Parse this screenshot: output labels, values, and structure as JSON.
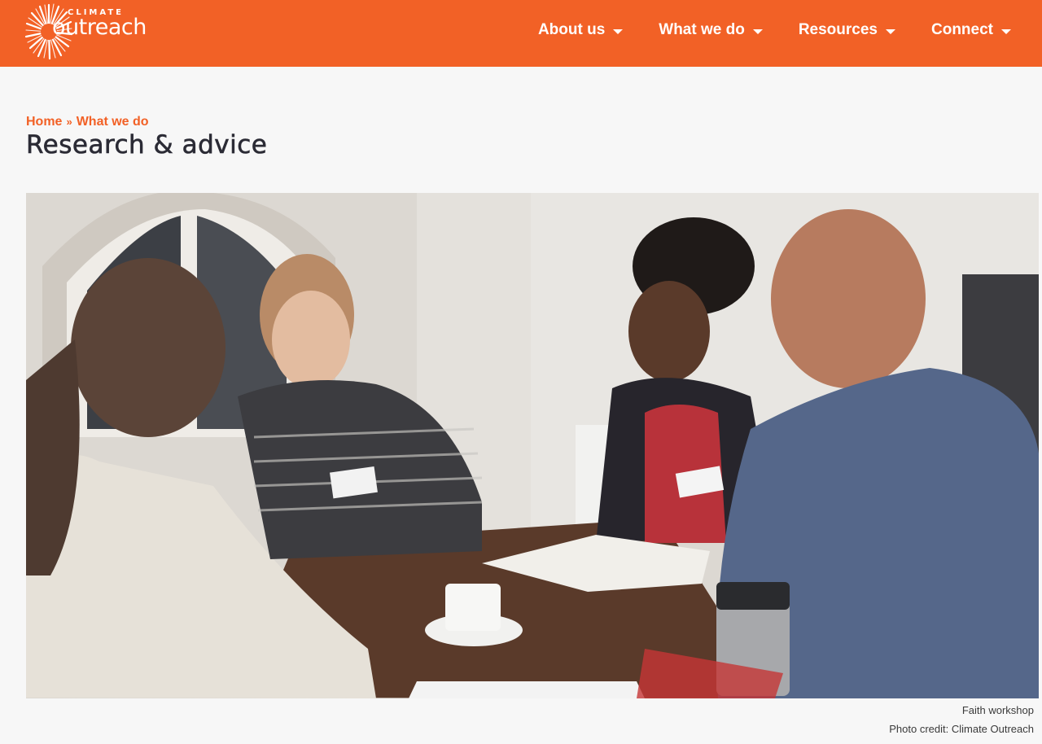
{
  "brand": {
    "logo_small": "CLIMATE",
    "logo_big": "outreach",
    "logo_icon": "sunburst-logo-icon",
    "accent_color": "#f26126"
  },
  "nav": {
    "items": [
      {
        "label": "About us",
        "icon": "chevron-down-icon"
      },
      {
        "label": "What we do",
        "icon": "chevron-down-icon"
      },
      {
        "label": "Resources",
        "icon": "chevron-down-icon"
      },
      {
        "label": "Connect",
        "icon": "chevron-down-icon"
      }
    ]
  },
  "breadcrumb": {
    "home": "Home",
    "separator": "»",
    "current": "What we do"
  },
  "page": {
    "title": "Research & advice"
  },
  "hero_image": {
    "caption": "Faith workshop",
    "credit": "Photo credit: Climate Outreach"
  }
}
